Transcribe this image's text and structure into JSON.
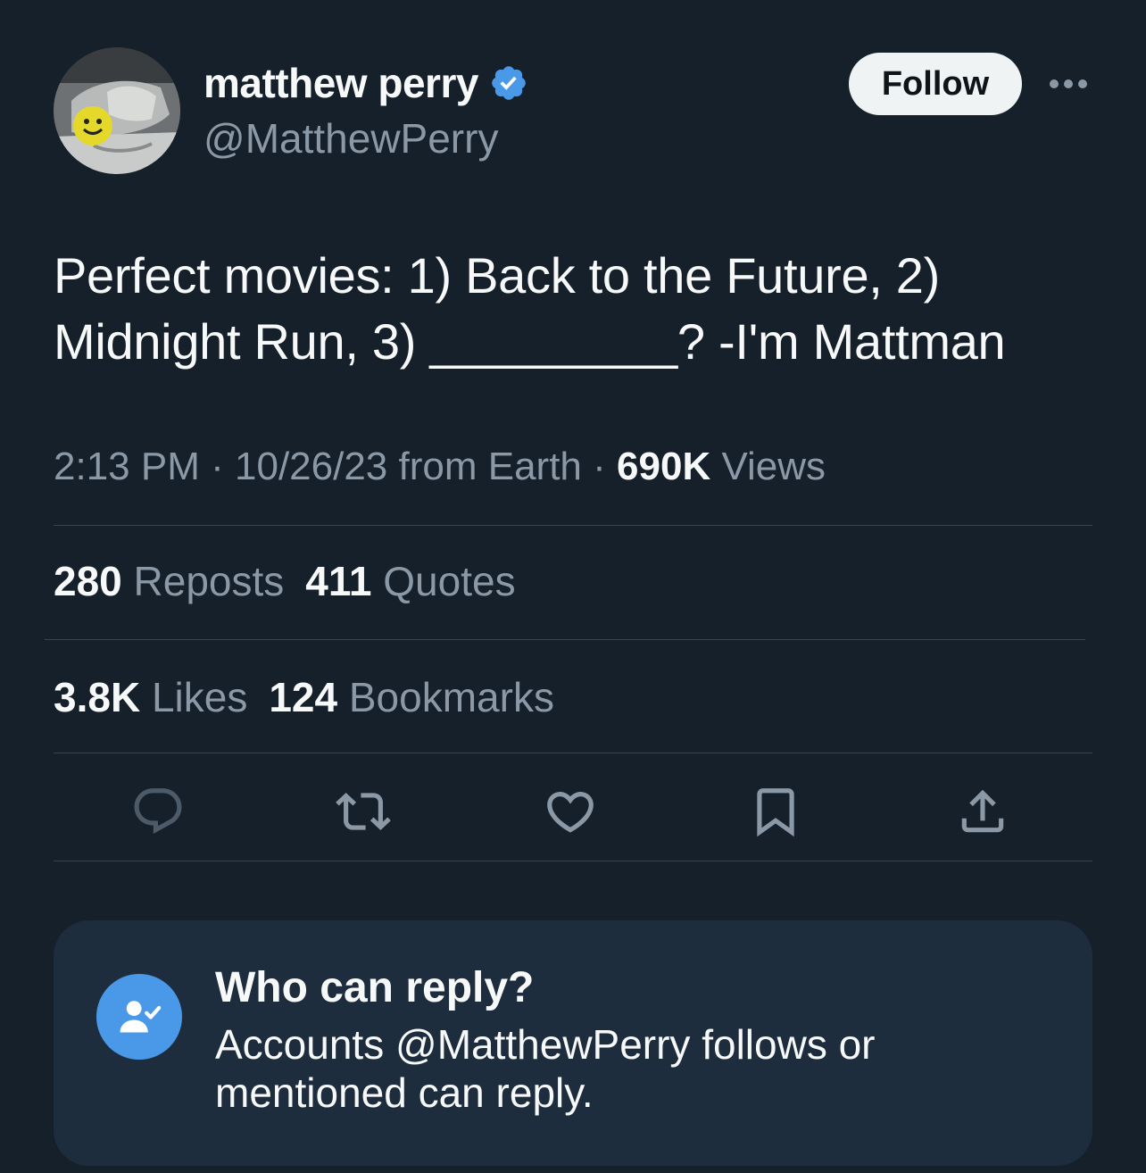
{
  "author": {
    "display_name": "matthew perry",
    "handle": "@MatthewPerry",
    "verified": true,
    "avatar_icon": "profile-photo"
  },
  "header": {
    "follow_label": "Follow",
    "more_icon": "more-horizontal-icon"
  },
  "tweet": {
    "text_line1": "Perfect movies: 1) Back to the Future, 2)",
    "text_line2": "Midnight Run, 3) _________? -I'm Mattman"
  },
  "meta": {
    "time": "2:13 PM",
    "separator": "·",
    "date": "10/26/23",
    "source": "from Earth",
    "views_count": "690K",
    "views_label": "Views"
  },
  "stats": {
    "reposts_count": "280",
    "reposts_label": "Reposts",
    "quotes_count": "411",
    "quotes_label": "Quotes",
    "likes_count": "3.8K",
    "likes_label": "Likes",
    "bookmarks_count": "124",
    "bookmarks_label": "Bookmarks"
  },
  "actions": [
    "reply-icon",
    "repost-icon",
    "like-icon",
    "bookmark-icon",
    "share-icon"
  ],
  "reply_settings": {
    "title": "Who can reply?",
    "body": "Accounts @MatthewPerry follows or mentioned can reply.",
    "icon": "person-check-icon"
  },
  "colors": {
    "background": "#15202b",
    "text_primary": "#f7f9f9",
    "text_secondary": "#8b98a5",
    "divider": "#38444d",
    "accent_blue": "#4a99e9",
    "card_bg": "#1e2d3d",
    "follow_bg": "#eff3f4"
  }
}
